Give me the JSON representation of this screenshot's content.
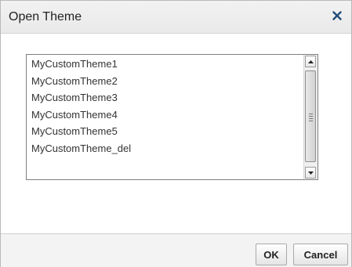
{
  "dialog": {
    "title": "Open Theme"
  },
  "themes": {
    "items": [
      "MyCustomTheme1",
      "MyCustomTheme2",
      "MyCustomTheme3",
      "MyCustomTheme4",
      "MyCustomTheme5",
      "MyCustomTheme_del"
    ]
  },
  "buttons": {
    "ok_label": "OK",
    "cancel_label": "Cancel"
  },
  "icons": {
    "close": "close-icon",
    "scroll_up": "scroll-up-arrow-icon",
    "scroll_down": "scroll-down-arrow-icon"
  },
  "colors": {
    "title_bar": "#efefef",
    "footer": "#f3f3f3",
    "close_icon": "#1f4e79",
    "text": "#333333"
  }
}
